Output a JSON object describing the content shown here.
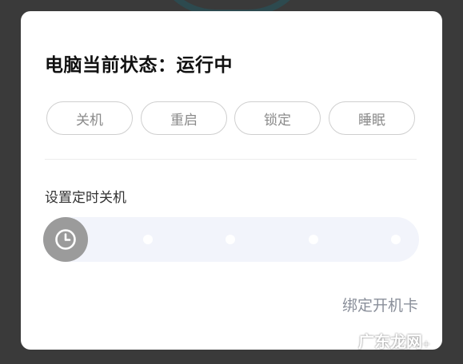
{
  "status": {
    "title": "电脑当前状态：运行中"
  },
  "actions": [
    {
      "label": "关机"
    },
    {
      "label": "重启"
    },
    {
      "label": "锁定"
    },
    {
      "label": "睡眠"
    }
  ],
  "timer": {
    "label": "设置定时关机",
    "icon": "clock-icon"
  },
  "footer": {
    "bind_card_label": "绑定开机卡"
  },
  "watermark": {
    "text": "广东龙网",
    "suffix": "+"
  },
  "colors": {
    "knob": "#9b9b9b",
    "track": "#f2f4fb",
    "link": "#8a8f9a"
  }
}
